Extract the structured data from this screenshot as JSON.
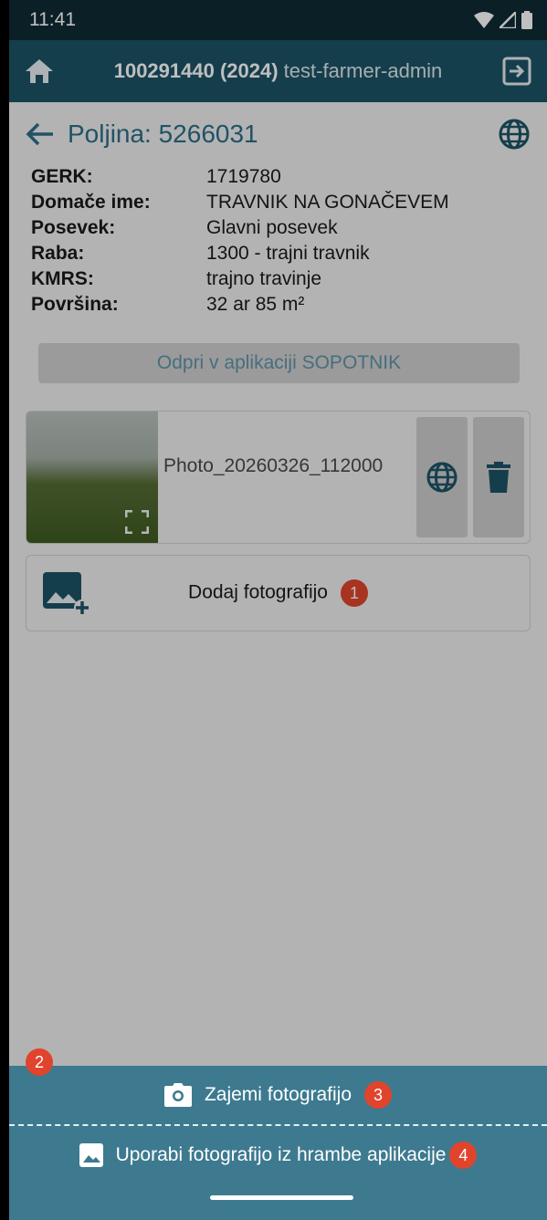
{
  "status": {
    "time": "11:41"
  },
  "appbar": {
    "id_year": "100291440 (2024)",
    "user": "test-farmer-admin"
  },
  "field": {
    "title": "Poljina: 5266031",
    "rows": [
      {
        "key": "GERK:",
        "value": "1719780"
      },
      {
        "key": "Domače ime:",
        "value": "TRAVNIK NA GONAČEVEM"
      },
      {
        "key": "Posevek:",
        "value": "Glavni posevek"
      },
      {
        "key": "Raba:",
        "value": "1300 - trajni travnik"
      },
      {
        "key": "KMRS:",
        "value": "trajno travinje"
      },
      {
        "key": "Površina:",
        "value": "32 ar 85 m²"
      }
    ],
    "open_button": "Odpri v aplikaciji SOPOTNIK"
  },
  "photo": {
    "name": "Photo_20260326_112000"
  },
  "add_photo": {
    "label": "Dodaj fotografijo",
    "badge": "1"
  },
  "sheet": {
    "badge": "2",
    "capture_label": "Zajemi fotografijo",
    "capture_badge": "3",
    "storage_label": "Uporabi fotografijo iz hrambe aplikacije",
    "storage_badge": "4"
  },
  "colors": {
    "appbar": "#1d5366",
    "accent": "#2c6e88",
    "sheet": "#3d7a90",
    "badge": "#e0442c"
  }
}
